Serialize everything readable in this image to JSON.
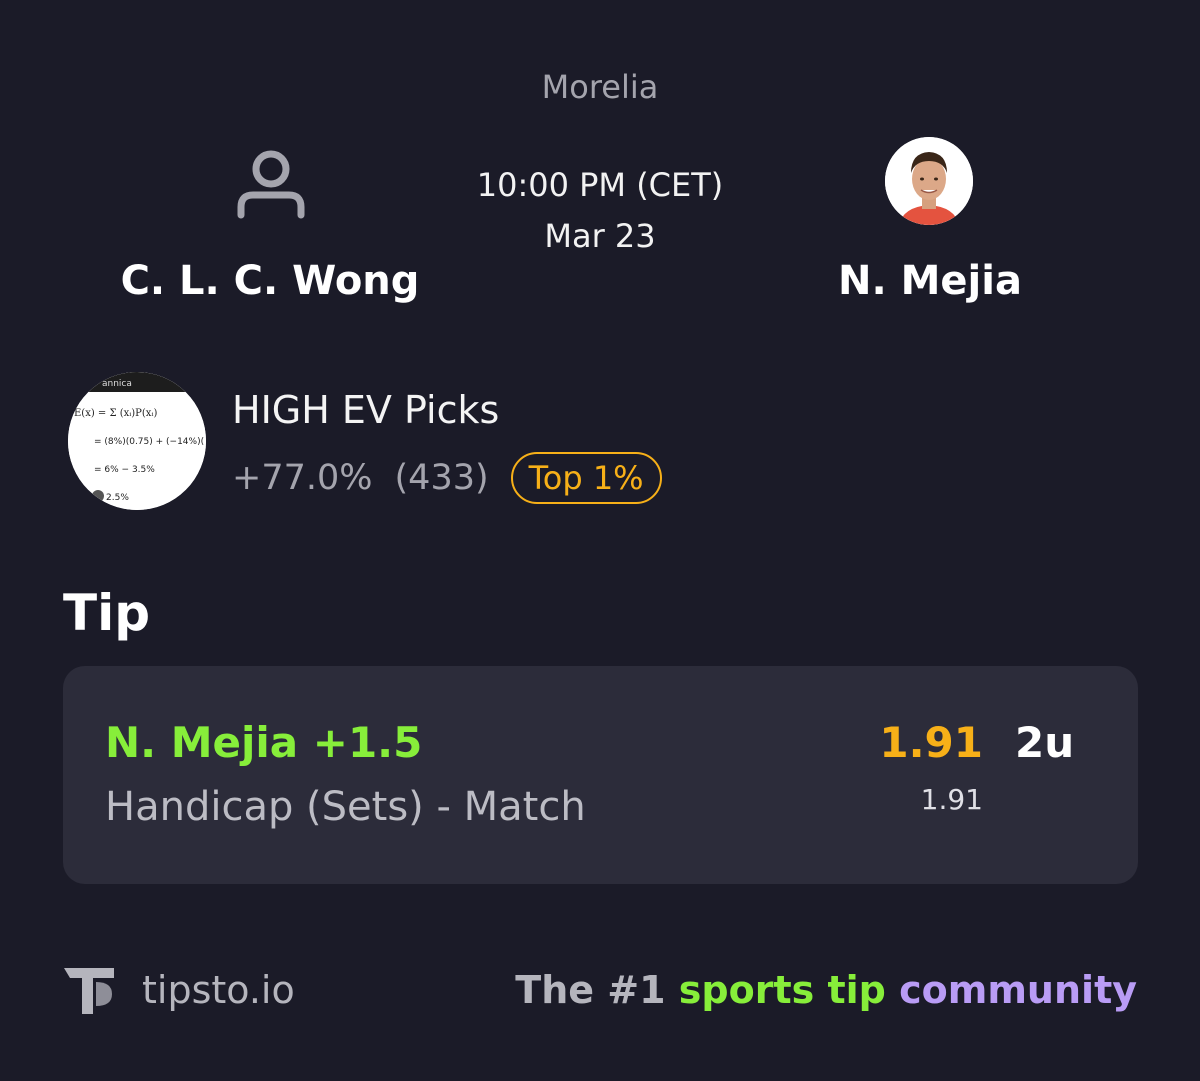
{
  "match": {
    "tournament": "Morelia",
    "time": "10:00 PM (CET)",
    "date": "Mar 23",
    "player1": {
      "name": "C. L. C. Wong",
      "avatar_icon": "user-placeholder-icon"
    },
    "player2": {
      "name": "N. Mejia",
      "avatar_icon": "player-photo"
    }
  },
  "tipster": {
    "name": "HIGH EV Picks",
    "roi": "+77.0%",
    "count": "(433)",
    "rank_badge": "Top 1%",
    "avatar_text": {
      "header": "annica",
      "line1": "E(x) = Σ (xᵢ)P(xᵢ)",
      "line2": "= (8%)(0.75) + (−14%)(",
      "line3": "= 6% − 3.5%",
      "line4": "2.5%"
    }
  },
  "tip": {
    "heading": "Tip",
    "selection": "N. Mejia +1.5",
    "market": "Handicap (Sets) - Match",
    "odds": "1.91",
    "stake": "2u",
    "closing_odds": "1.91"
  },
  "footer": {
    "site": "tipsto.io",
    "tagline_pre": "The #1 ",
    "tagline_sports": "sports tip",
    "tagline_space": " ",
    "tagline_community": "community"
  },
  "colors": {
    "background": "#1b1b28",
    "card": "#2c2c3a",
    "accent_green": "#87ee3a",
    "accent_gold": "#f7b018",
    "accent_purple": "#b99cf5"
  }
}
